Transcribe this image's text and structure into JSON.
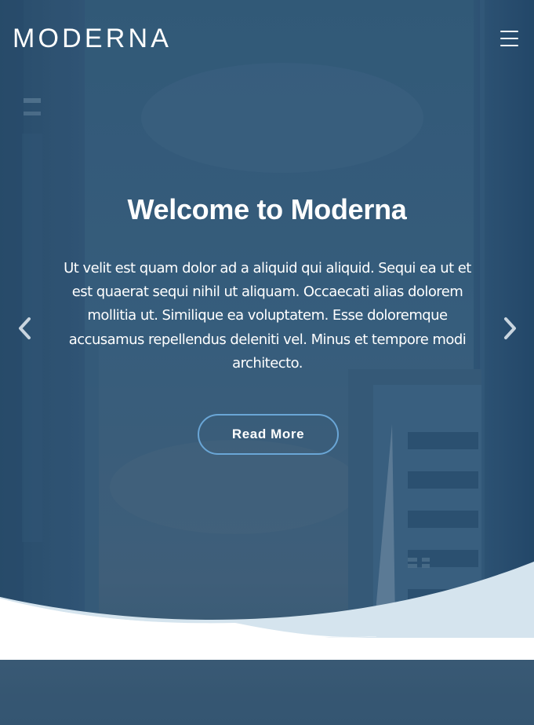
{
  "header": {
    "brand": "MODERNA",
    "menu_icon": "hamburger-menu-icon"
  },
  "hero": {
    "title": "Welcome to Moderna",
    "description": "Ut velit est quam dolor ad a aliquid qui aliquid. Sequi ea ut et est quaerat sequi nihil ut aliquam. Occaecati alias dolorem mollitia ut. Similique ea voluptatem. Esse doloremque accusamus repellendus deleniti vel. Minus et tempore modi architecto.",
    "button_label": "Read More",
    "prev_icon": "chevron-left-icon",
    "next_icon": "chevron-right-icon"
  },
  "colors": {
    "overlay": "#2f5877",
    "button_border": "#6aa6d6",
    "wave_light": "#d5e4ee",
    "background": "#ffffff"
  }
}
